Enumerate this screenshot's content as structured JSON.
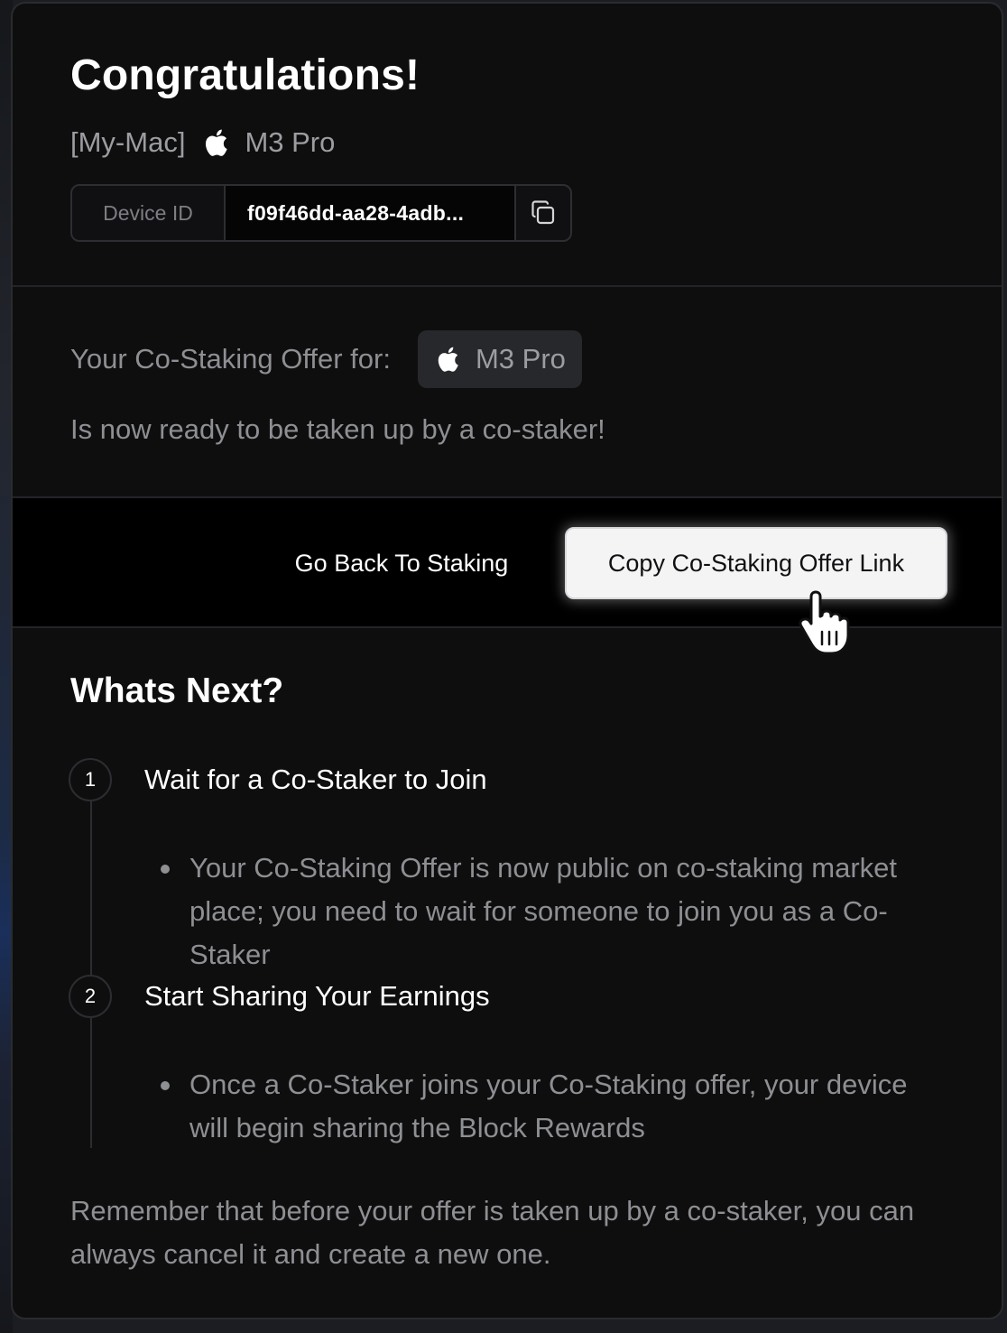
{
  "header": {
    "title": "Congratulations!",
    "device_name": "[My-Mac]",
    "chip_name": "M3 Pro"
  },
  "device_id": {
    "label": "Device ID",
    "value": "f09f46dd-aa28-4adb..."
  },
  "offer": {
    "label": "Your Co-Staking Offer for:",
    "chip_name": "M3 Pro",
    "status": "Is now ready to be taken up by a co-staker!"
  },
  "actions": {
    "back_label": "Go Back To Staking",
    "copy_link_label": "Copy Co-Staking Offer Link"
  },
  "next": {
    "title": "Whats Next?",
    "steps": [
      {
        "number": "1",
        "title": "Wait for a Co-Staker to Join",
        "bullet": "Your Co-Staking Offer is now public on co-staking market place; you need to wait for someone to join you as a Co-Staker"
      },
      {
        "number": "2",
        "title": "Start Sharing Your Earnings",
        "bullet": "Once a Co-Staker joins your Co-Staking offer, your device will begin sharing the Block Rewards"
      }
    ],
    "remember": "Remember that before your offer is taken up by a co-staker, you can always cancel it and create a new one."
  },
  "icons": {
    "chip_logo": "apple-icon",
    "copy": "copy-icon",
    "cursor": "hand-pointer-icon"
  },
  "colors": {
    "panel_bg": "#0e0e0f",
    "primary_button_bg": "#f4f4f5",
    "muted_text": "#8e8f93"
  }
}
